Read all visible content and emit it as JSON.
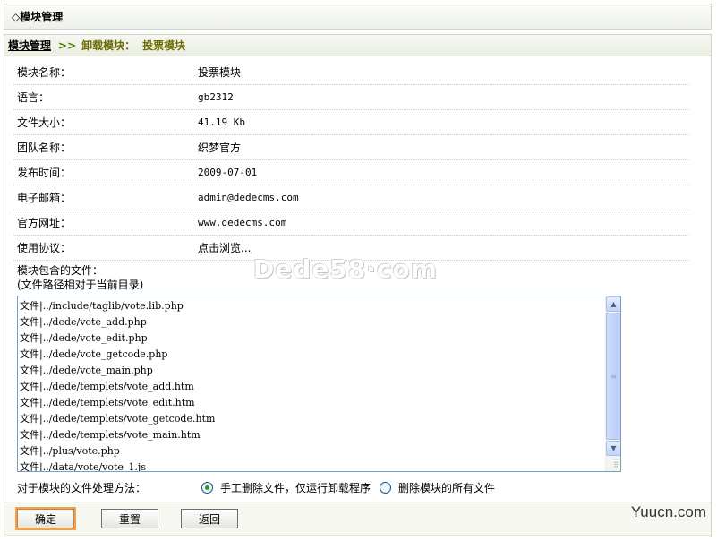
{
  "title": "◇模块管理",
  "breadcrumb": {
    "home": "模块管理",
    "sep": ">>",
    "mid": "卸载模块：",
    "current": "投票模块"
  },
  "info_rows": [
    {
      "label": "模块名称：",
      "value": "投票模块"
    },
    {
      "label": "语言：",
      "value": "gb2312"
    },
    {
      "label": "文件大小：",
      "value": "41.19 Kb"
    },
    {
      "label": "团队名称：",
      "value": "织梦官方"
    },
    {
      "label": "发布时间：",
      "value": "2009-07-01"
    },
    {
      "label": "电子邮箱：",
      "value": "admin@dedecms.com"
    },
    {
      "label": "官方网址：",
      "value": "www.dedecms.com"
    },
    {
      "label": "使用协议：",
      "value": "点击浏览..."
    }
  ],
  "files_label": "模块包含的文件：",
  "files_note": "(文件路径相对于当前目录)",
  "watermark": "Dede58·com",
  "files": [
    "文件|../include/taglib/vote.lib.php",
    "文件|../dede/vote_add.php",
    "文件|../dede/vote_edit.php",
    "文件|../dede/vote_getcode.php",
    "文件|../dede/vote_main.php",
    "文件|../dede/templets/vote_add.htm",
    "文件|../dede/templets/vote_edit.htm",
    "文件|../dede/templets/vote_getcode.htm",
    "文件|../dede/templets/vote_main.htm",
    "文件|../plus/vote.php",
    "文件|../data/vote/vote_1.js"
  ],
  "method": {
    "label": "对于模块的文件处理方法：",
    "option1": "手工删除文件，仅运行卸载程序",
    "option2": "删除模块的所有文件",
    "selected": "option1"
  },
  "buttons": {
    "ok": "确定",
    "reset": "重置",
    "back": "返回"
  },
  "corner_mark": "Yuucn.com"
}
